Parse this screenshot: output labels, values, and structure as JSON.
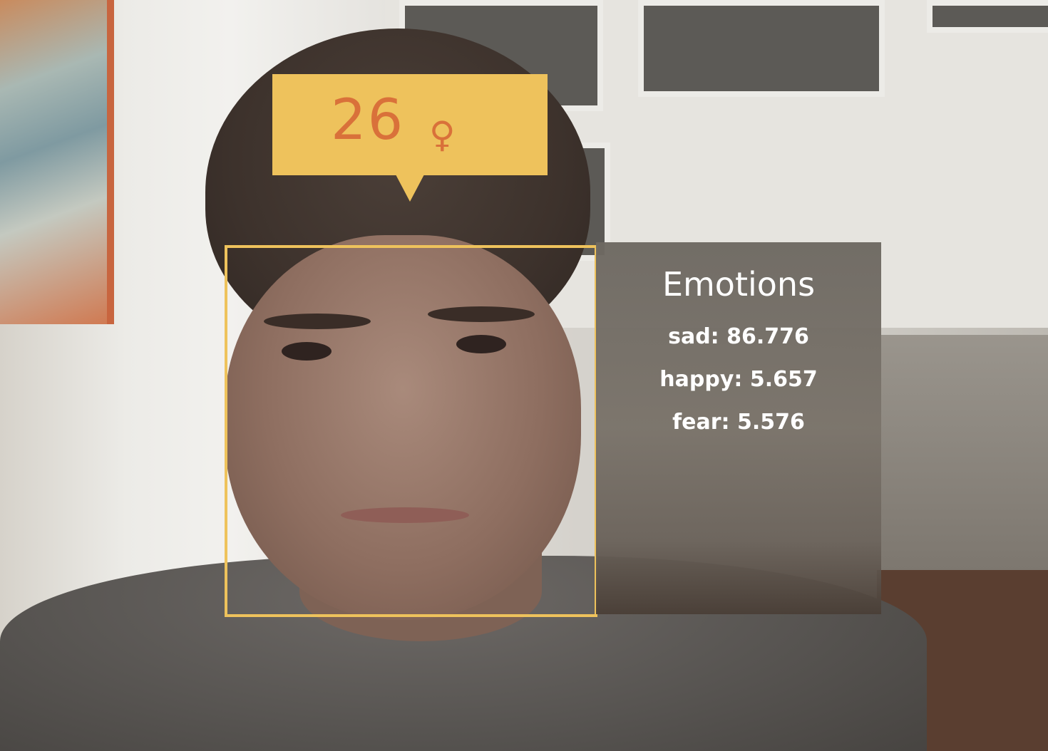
{
  "overlay": {
    "age": "26",
    "gender_icon": "female-symbol",
    "gender_glyph": "♀",
    "accent_color": "#eec25c",
    "age_text_color": "#d9713a"
  },
  "emotions": {
    "title": "Emotions",
    "items": [
      {
        "label": "sad:",
        "value": "86.776"
      },
      {
        "label": "happy:",
        "value": "5.657"
      },
      {
        "label": "fear:",
        "value": "5.576"
      }
    ]
  }
}
